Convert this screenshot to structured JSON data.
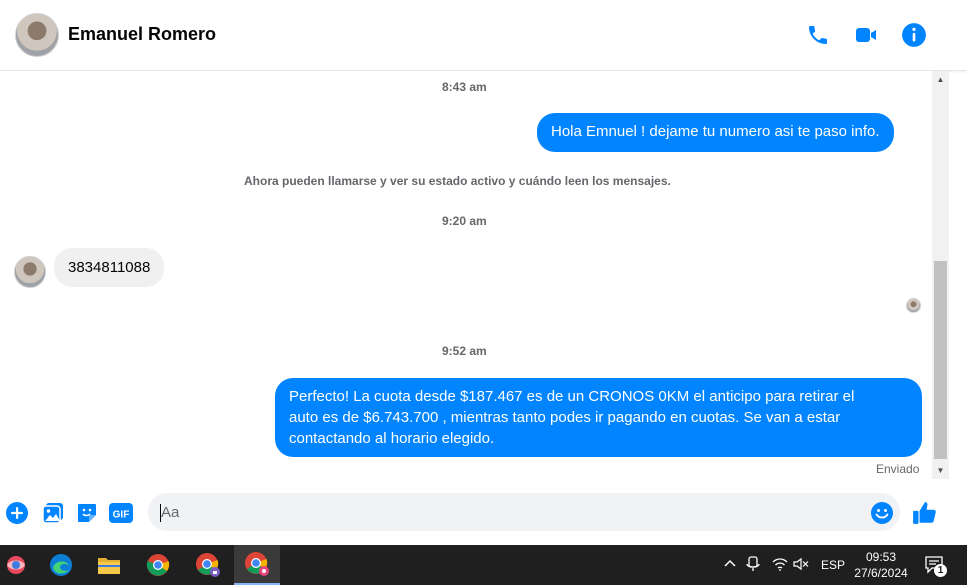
{
  "header": {
    "contact_name": "Emanuel Romero",
    "actions": [
      "phone-icon",
      "video-camera-icon",
      "info-icon"
    ],
    "accent_color": "#0084ff"
  },
  "chat": {
    "messages": [
      {
        "type": "timestamp",
        "text": "8:43 am"
      },
      {
        "type": "outgoing",
        "text": "Hola Emnuel ! dejame tu numero asi te paso info."
      },
      {
        "type": "system",
        "text": "Ahora pueden llamarse y ver su estado activo y cuándo leen los mensajes."
      },
      {
        "type": "timestamp",
        "text": "9:20 am"
      },
      {
        "type": "incoming",
        "text": "3834811088"
      },
      {
        "type": "timestamp",
        "text": "9:52 am"
      },
      {
        "type": "outgoing",
        "lines": [
          "Perfecto! La cuota desde $187.467 es de un CRONOS 0KM el anticipo para retirar el",
          "auto es de $6.743.700 , mientras tanto podes ir pagando en cuotas. Se van a estar",
          "contactando al horario elegido."
        ]
      }
    ],
    "status": "Enviado"
  },
  "composer": {
    "placeholder": "Aa",
    "actions": [
      "plus-icon",
      "photo-icon",
      "sticker-icon",
      "gif-icon"
    ],
    "gif_label": "GIF",
    "emoji_icon": "smile-icon",
    "like_icon": "thumbs-up-icon"
  },
  "taskbar": {
    "apps": [
      "windows-pinned-icon",
      "edge-icon",
      "file-explorer-icon",
      "chrome-icon",
      "chrome-profile-icon",
      "chrome-profile-active-icon"
    ],
    "tray": {
      "language": "ESP",
      "time": "09:53",
      "date": "27/6/2024",
      "notifications": "1"
    }
  }
}
